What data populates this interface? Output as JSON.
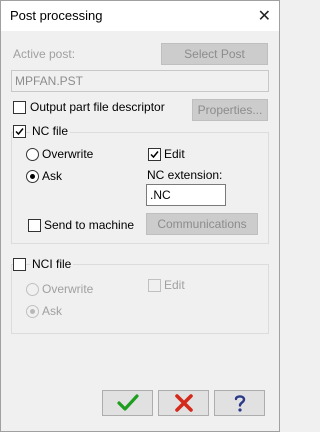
{
  "window": {
    "title": "Post processing",
    "close_glyph": "✕"
  },
  "active_post": {
    "label": "Active post:",
    "select_button": "Select Post",
    "value": "MPFAN.PST"
  },
  "output_descriptor": {
    "label": "Output part file descriptor",
    "checked": false,
    "properties_button": "Properties..."
  },
  "nc_file": {
    "label": "NC file",
    "checked": true,
    "overwrite_label": "Overwrite",
    "ask_label": "Ask",
    "selected_mode": "Ask",
    "edit_label": "Edit",
    "edit_checked": true,
    "extension_label": "NC extension:",
    "extension_value": ".NC",
    "send_label": "Send to machine",
    "send_checked": false,
    "communications_button": "Communications"
  },
  "nci_file": {
    "label": "NCI file",
    "checked": false,
    "overwrite_label": "Overwrite",
    "ask_label": "Ask",
    "selected_mode": "Ask",
    "edit_label": "Edit",
    "edit_checked": false
  },
  "footer": {
    "ok_icon": "green-checkmark-icon",
    "cancel_icon": "red-x-icon",
    "help_icon": "question-mark-icon",
    "ok_color": "#1e9e1e",
    "cancel_color": "#d42a1a",
    "help_color": "#2a3a88"
  }
}
